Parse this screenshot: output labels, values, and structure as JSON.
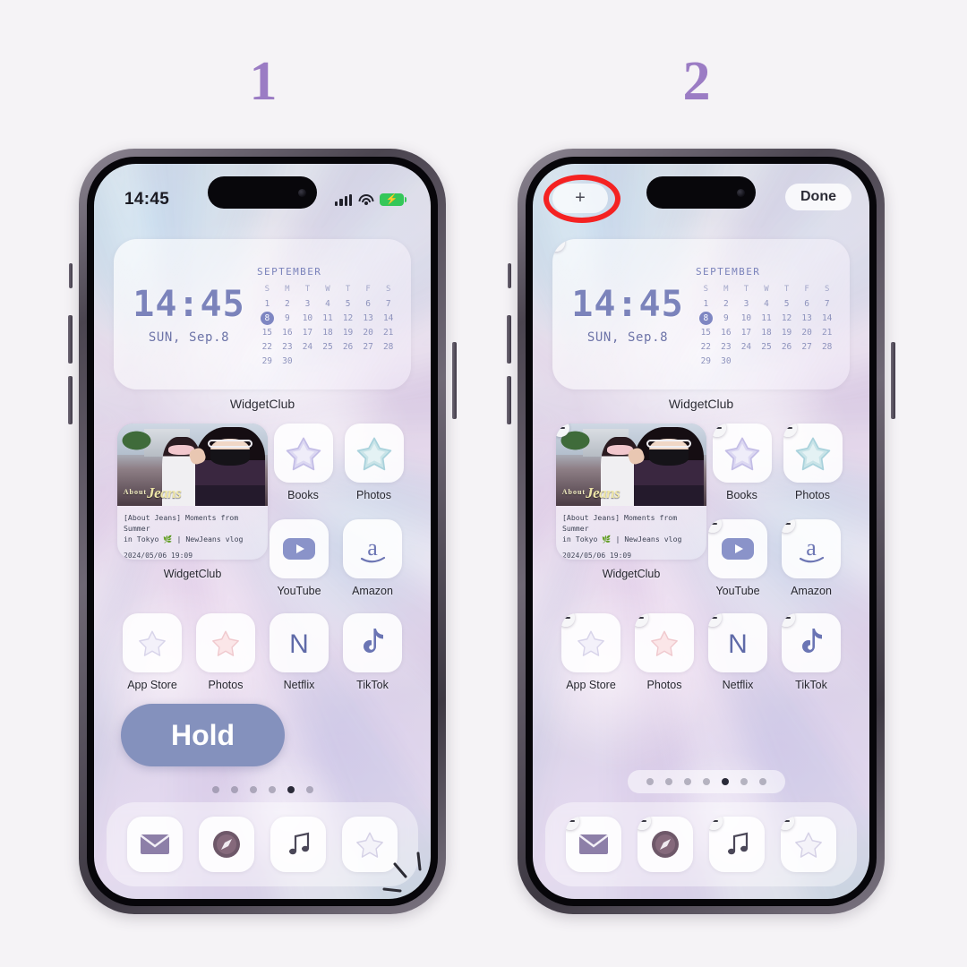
{
  "steps": [
    {
      "number": "1"
    },
    {
      "number": "2"
    }
  ],
  "phone1": {
    "statusbar": {
      "time": "14:45",
      "signal_icon": "cellular-bars-icon",
      "wifi_icon": "wifi-icon",
      "battery_icon": "battery-charging-icon",
      "battery_color": "#34c759"
    },
    "widget": {
      "clock": "14:45",
      "date": "SUN, Sep.8",
      "calendar_month": "SEPTEMBER",
      "dow": [
        "S",
        "M",
        "T",
        "W",
        "T",
        "F",
        "S"
      ],
      "days": [
        1,
        2,
        3,
        4,
        5,
        6,
        7,
        8,
        9,
        10,
        11,
        12,
        13,
        14,
        15,
        16,
        17,
        18,
        19,
        20,
        21,
        22,
        23,
        24,
        25,
        26,
        27,
        28,
        29,
        30
      ],
      "today": 8,
      "today_color": "#7e86c2",
      "label": "WidgetClub"
    },
    "video_widget": {
      "logo": "Jeans",
      "logo_prefix": "About",
      "title_line1": "[About Jeans] Moments from Summer",
      "title_line2": "in Tokyo 🌿 | NewJeans vlog",
      "date": "2024/05/06 19:09",
      "label": "WidgetClub"
    },
    "row1_apps": [
      {
        "label": "Books",
        "icon": "star-icon"
      },
      {
        "label": "Photos",
        "icon": "star-icon"
      }
    ],
    "row2_apps": [
      {
        "label": "YouTube",
        "icon": "youtube-icon"
      },
      {
        "label": "Amazon",
        "icon": "amazon-icon"
      }
    ],
    "row3_apps": [
      {
        "label": "App Store",
        "icon": "star-icon"
      },
      {
        "label": "Photos",
        "icon": "star-icon"
      },
      {
        "label": "Netflix",
        "icon": "netflix-n-icon"
      },
      {
        "label": "TikTok",
        "icon": "tiktok-note-icon"
      }
    ],
    "hold_button": "Hold",
    "dots": {
      "count": 6,
      "active_index": 5
    },
    "dock": [
      {
        "icon": "mail-icon"
      },
      {
        "icon": "safari-compass-icon"
      },
      {
        "icon": "music-note-icon"
      },
      {
        "icon": "star-icon"
      }
    ]
  },
  "phone2": {
    "topbar": {
      "add_button": "+",
      "done_button": "Done",
      "highlight_color": "#f42222"
    },
    "widget": {
      "clock": "14:45",
      "date": "SUN, Sep.8",
      "calendar_month": "SEPTEMBER",
      "dow": [
        "S",
        "M",
        "T",
        "W",
        "T",
        "F",
        "S"
      ],
      "days": [
        1,
        2,
        3,
        4,
        5,
        6,
        7,
        8,
        9,
        10,
        11,
        12,
        13,
        14,
        15,
        16,
        17,
        18,
        19,
        20,
        21,
        22,
        23,
        24,
        25,
        26,
        27,
        28,
        29,
        30
      ],
      "today": 8,
      "label": "WidgetClub"
    },
    "video_widget": {
      "title_line1": "[About Jeans] Moments from Summer",
      "title_line2": "in Tokyo 🌿 | NewJeans vlog",
      "date": "2024/05/06 19:09",
      "label": "WidgetClub"
    },
    "row1_apps": [
      {
        "label": "Books",
        "icon": "star-icon"
      },
      {
        "label": "Photos",
        "icon": "star-icon"
      }
    ],
    "row2_apps": [
      {
        "label": "YouTube",
        "icon": "youtube-icon"
      },
      {
        "label": "Amazon",
        "icon": "amazon-icon"
      }
    ],
    "row3_apps": [
      {
        "label": "App Store",
        "icon": "star-icon"
      },
      {
        "label": "Photos",
        "icon": "star-icon"
      },
      {
        "label": "Netflix",
        "icon": "netflix-n-icon"
      },
      {
        "label": "TikTok",
        "icon": "tiktok-note-icon"
      }
    ],
    "dots": {
      "count": 7,
      "active_index": 5
    },
    "dock": [
      {
        "icon": "mail-icon"
      },
      {
        "icon": "safari-compass-icon"
      },
      {
        "icon": "music-note-icon"
      },
      {
        "icon": "star-icon"
      }
    ]
  },
  "theme": {
    "page_background": "#f5f3f6",
    "step_number_color": "#9b7cc4",
    "hold_pill_color": "#8491bd",
    "widget_accent": "#7b83bb"
  }
}
